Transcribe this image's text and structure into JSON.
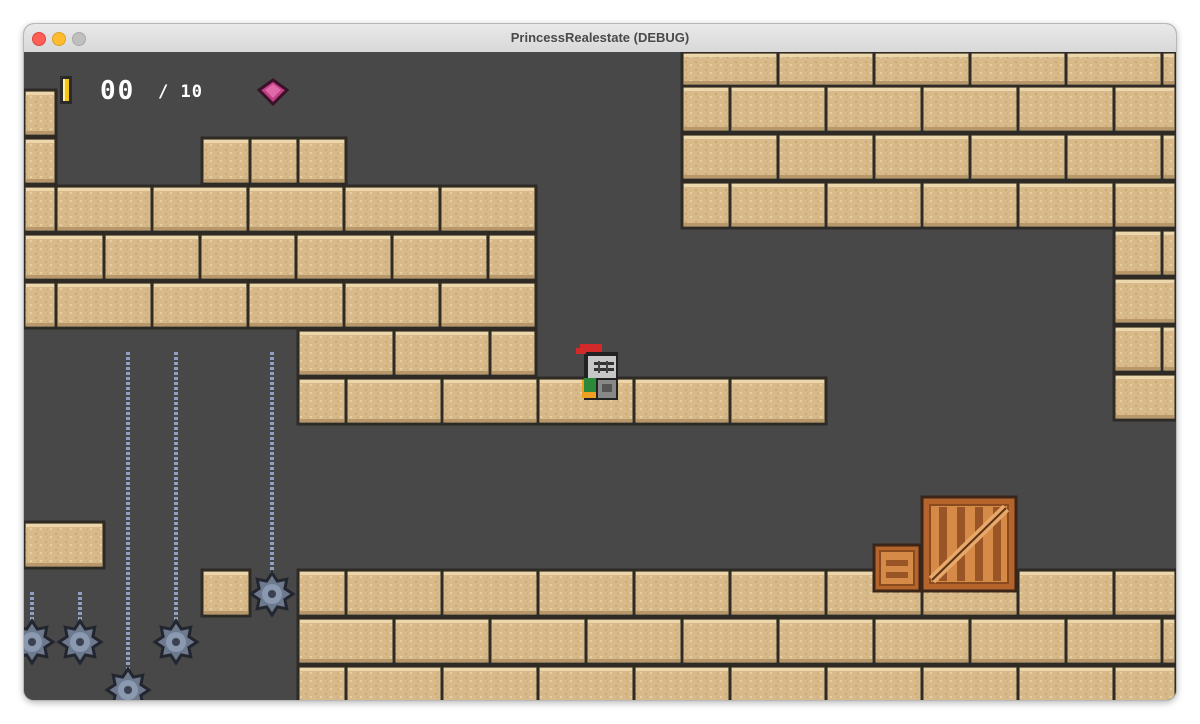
{
  "window": {
    "title": "PrincessRealestate (DEBUG)"
  },
  "hud": {
    "coins_collected": "00",
    "coins_total": "/ 10",
    "coin_icon": "coin-icon",
    "gem_icon": "gem-icon"
  },
  "colors": {
    "background": "#484848",
    "brick": "#d7b98a",
    "brick_outline": "#2e2a26",
    "chain": "#8fa0c4",
    "spike_ball": "#6d7a8e",
    "crate": "#c8783a",
    "gem": "#c23f88",
    "coin": "#f5c518"
  }
}
